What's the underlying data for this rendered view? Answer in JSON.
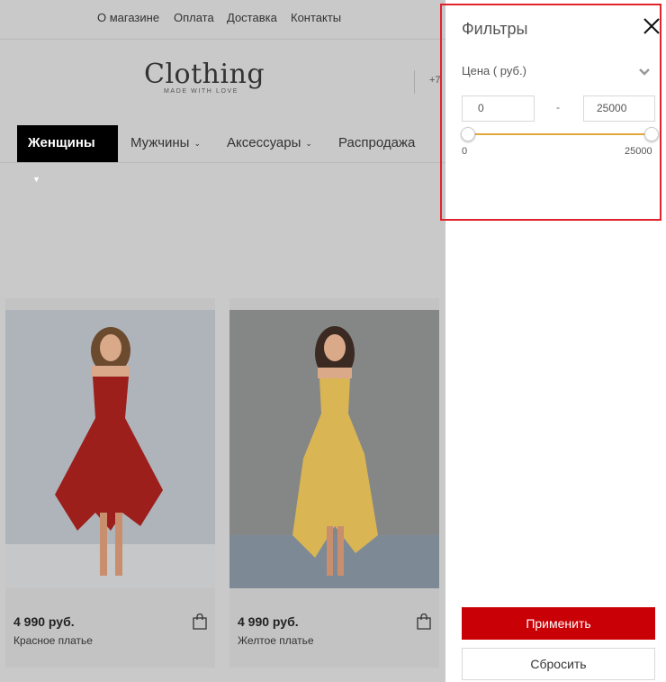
{
  "topnav": {
    "items": [
      {
        "label": "О магазине"
      },
      {
        "label": "Оплата"
      },
      {
        "label": "Доставка"
      },
      {
        "label": "Контакты"
      }
    ]
  },
  "header": {
    "logo_text": "Clothing",
    "logo_tagline": "MADE WITH LOVE",
    "phone_fragment": "+7"
  },
  "catnav": {
    "items": [
      {
        "label": "Женщины",
        "active": true
      },
      {
        "label": "Мужчины"
      },
      {
        "label": "Аксессуары"
      },
      {
        "label": "Распродажа"
      }
    ]
  },
  "products": [
    {
      "price": "4 990 руб.",
      "name": "Красное платье",
      "dress_color": "#9c1f1c",
      "bg_color": "#aeb4ba"
    },
    {
      "price": "4 990 руб.",
      "name": "Желтое платье",
      "dress_color": "#d9b553",
      "bg_color": "#858686"
    }
  ],
  "filters": {
    "title": "Фильтры",
    "price_section": {
      "label": "Цена ( руб.)",
      "min_value": "0",
      "max_value": "25000",
      "range_min_label": "0",
      "range_max_label": "25000"
    },
    "apply_label": "Применить",
    "reset_label": "Сбросить",
    "accent_color": "#e2a83c",
    "apply_color": "#c90006",
    "highlight_color": "#e0242c"
  }
}
